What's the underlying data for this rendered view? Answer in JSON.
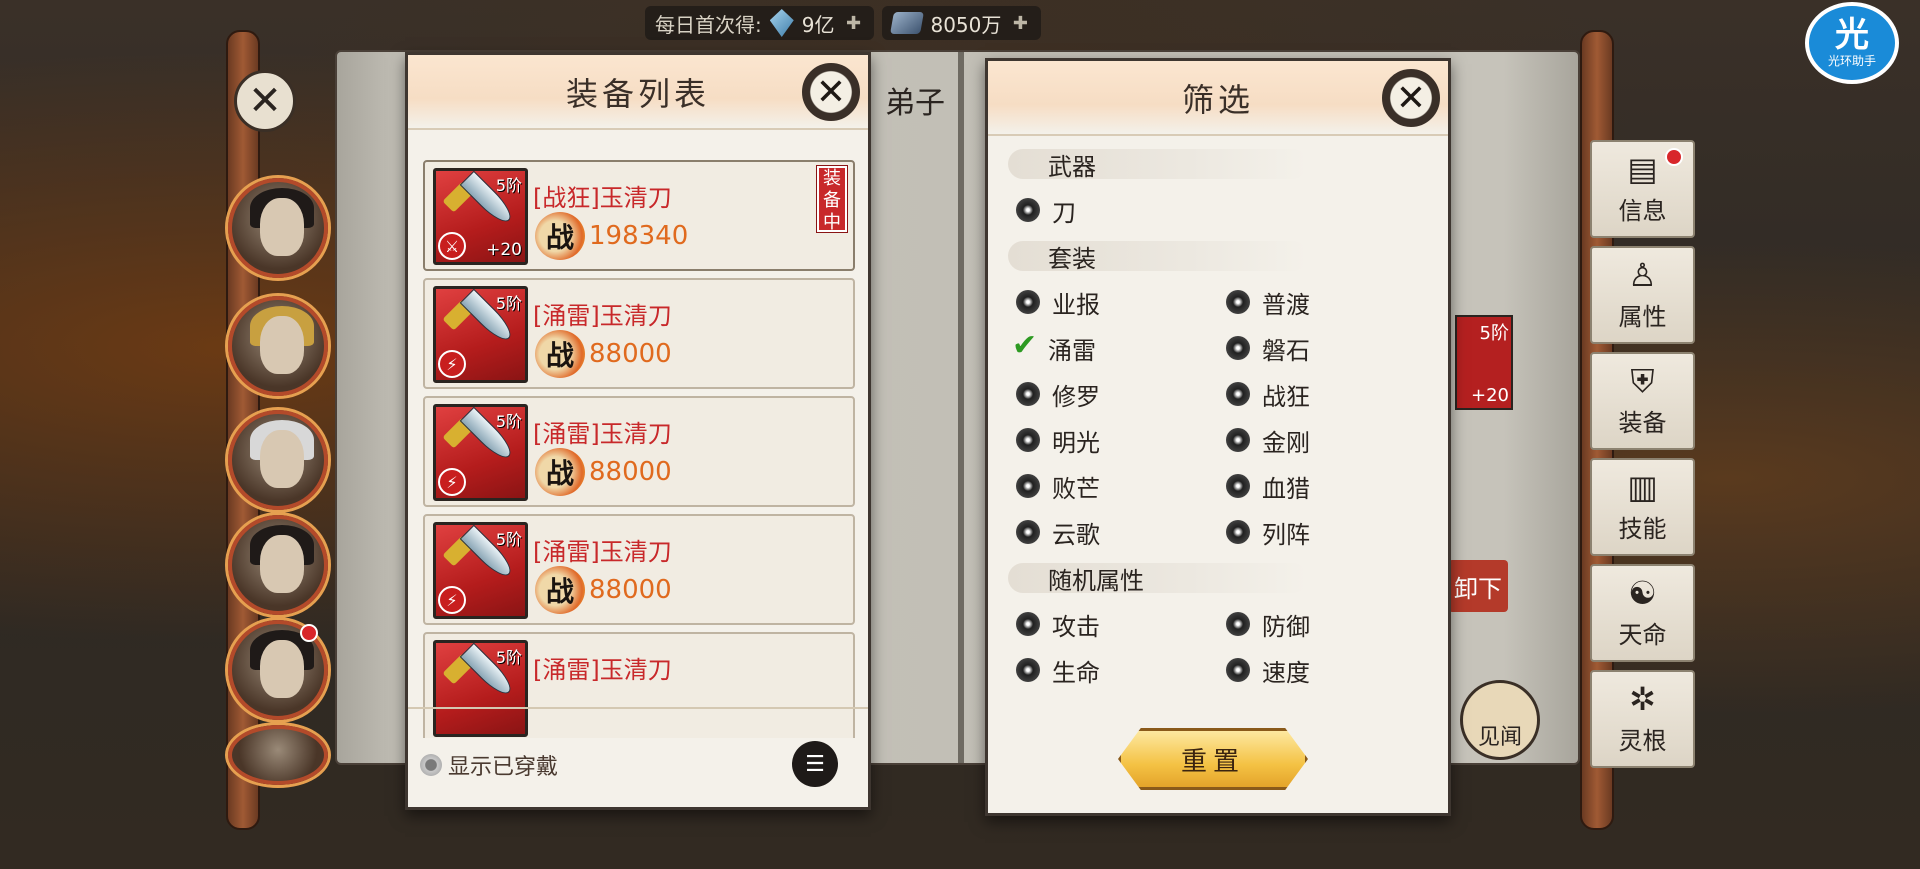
{
  "topbar": {
    "daily_label": "每日首次得:",
    "gem_amount": "9亿",
    "ore_amount": "8050万"
  },
  "app_badge": {
    "glyph": "光",
    "label": "光环助手"
  },
  "background": {
    "mid_title_fragment": "弟子",
    "mid_right_level": "5阶",
    "mid_right_plus": "+20",
    "mid_button_fragment": "卸下",
    "mid_circle_label": "见闻"
  },
  "side_tabs": [
    {
      "label": "信息",
      "icon": "book-icon",
      "dot": true
    },
    {
      "label": "属性",
      "icon": "person-icon",
      "dot": false
    },
    {
      "label": "装备",
      "icon": "armor-icon",
      "dot": false
    },
    {
      "label": "技能",
      "icon": "scroll-icon",
      "dot": false
    },
    {
      "label": "天命",
      "icon": "fate-icon",
      "dot": false
    },
    {
      "label": "灵根",
      "icon": "root-icon",
      "dot": false
    }
  ],
  "equip_panel": {
    "title": "装备列表",
    "items": [
      {
        "name": "[战狂]玉清刀",
        "level": "5阶",
        "plus": "+20",
        "power": "198340",
        "equipped_tag": "装备中",
        "badge": "⚔"
      },
      {
        "name": "[涌雷]玉清刀",
        "level": "5阶",
        "plus": "",
        "power": "88000",
        "equipped_tag": "",
        "badge": "⚡"
      },
      {
        "name": "[涌雷]玉清刀",
        "level": "5阶",
        "plus": "",
        "power": "88000",
        "equipped_tag": "",
        "badge": "⚡"
      },
      {
        "name": "[涌雷]玉清刀",
        "level": "5阶",
        "plus": "",
        "power": "88000",
        "equipped_tag": "",
        "badge": "⚡"
      },
      {
        "name": "[涌雷]玉清刀",
        "level": "5阶",
        "plus": "",
        "power": "",
        "equipped_tag": "",
        "badge": "⚡"
      }
    ],
    "power_glyph": "战",
    "show_worn_label": "显示已穿戴"
  },
  "filter_panel": {
    "title": "筛选",
    "sections": {
      "weapon": {
        "title": "武器",
        "options": [
          "刀"
        ]
      },
      "set": {
        "title": "套装",
        "rows": [
          [
            "业报",
            "普渡"
          ],
          [
            "涌雷",
            "磐石"
          ],
          [
            "修罗",
            "战狂"
          ],
          [
            "明光",
            "金刚"
          ],
          [
            "败芒",
            "血猎"
          ],
          [
            "云歌",
            "列阵"
          ]
        ],
        "checked": "涌雷"
      },
      "random": {
        "title": "随机属性",
        "rows": [
          [
            "攻击",
            "防御"
          ],
          [
            "生命",
            "速度"
          ]
        ]
      }
    },
    "reset_label": "重置"
  },
  "colors": {
    "panel_bg": "#f4f1ea",
    "equip_name": "#c8282a",
    "power_value": "#e06a1e",
    "check": "#2d9a22",
    "reset_gold": "#f4c244"
  }
}
